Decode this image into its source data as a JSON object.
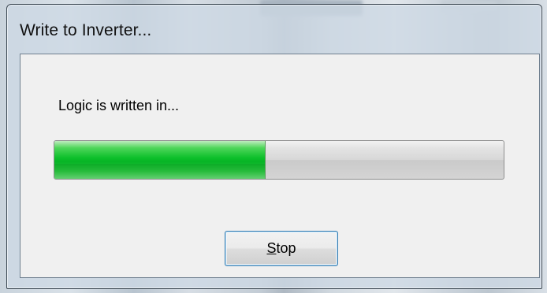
{
  "window": {
    "title": "Write to Inverter..."
  },
  "dialog": {
    "message": "Logic is written in...",
    "progress": {
      "fraction": 0.47,
      "color": "#0cbf2a"
    },
    "stop_button": {
      "mnemonic": "S",
      "rest": "top"
    }
  }
}
